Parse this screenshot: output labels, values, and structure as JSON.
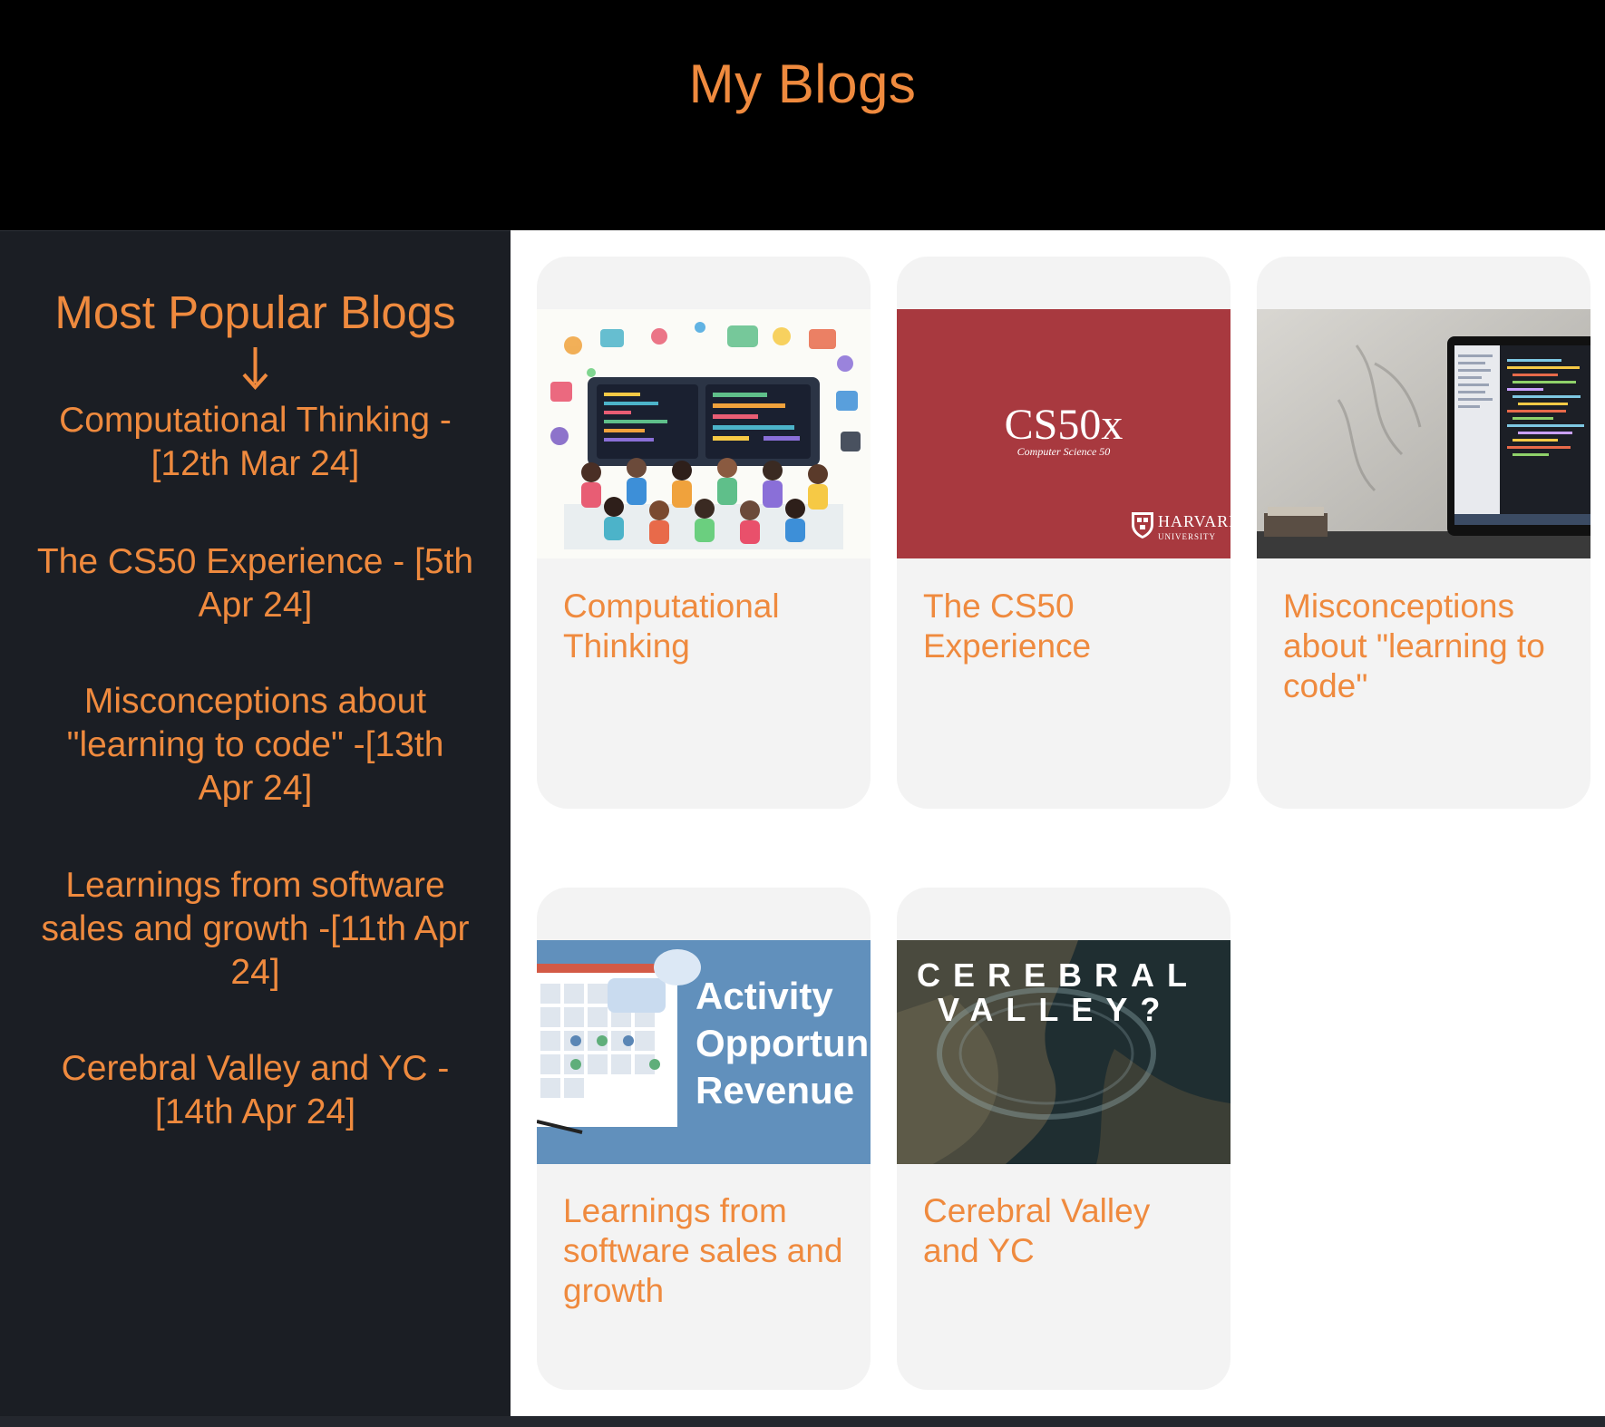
{
  "header": {
    "title": "My Blogs"
  },
  "sidebar": {
    "heading": "Most Popular Blogs",
    "arrow_icon": "arrow-down-icon",
    "links": [
      {
        "text": "Computational Thinking - [12th Mar 24]"
      },
      {
        "text": "The CS50 Experience - [5th Apr 24]"
      },
      {
        "text": "Misconceptions about \"learning to code\" -[13th Apr 24]"
      },
      {
        "text": "Learnings from software sales and growth -[11th Apr 24]"
      },
      {
        "text": "Cerebral Valley and YC - [14th Apr 24]"
      }
    ]
  },
  "cards": [
    {
      "title": "Computational Thinking",
      "image": "kids-coding-illustration"
    },
    {
      "title": "The CS50 Experience",
      "image": "cs50x-banner",
      "image_text": {
        "main": "CS50x",
        "sub": "Computer Science 50",
        "logo": "HARVARD",
        "logo_sub": "UNIVERSITY"
      }
    },
    {
      "title": "Misconceptions about \"learning to code\"",
      "image": "laptop-code-photo"
    },
    {
      "title": "Learnings from software sales and growth",
      "image": "activity-opportunity-revenue-graphic",
      "image_text": {
        "line1": "Activity",
        "line2": "Opportunity",
        "line3": "Revenue"
      }
    },
    {
      "title": "Cerebral Valley and YC",
      "image": "cerebral-valley-map",
      "image_text": {
        "line1": "CEREBRAL",
        "line2": "VALLEY?"
      }
    }
  ],
  "colors": {
    "accent": "#ef8a3e",
    "header_bg": "#000000",
    "sidebar_bg": "#1b1e24",
    "card_bg": "#f3f3f3",
    "cs50_red": "#a8393f",
    "sales_blue": "#6190bc"
  }
}
